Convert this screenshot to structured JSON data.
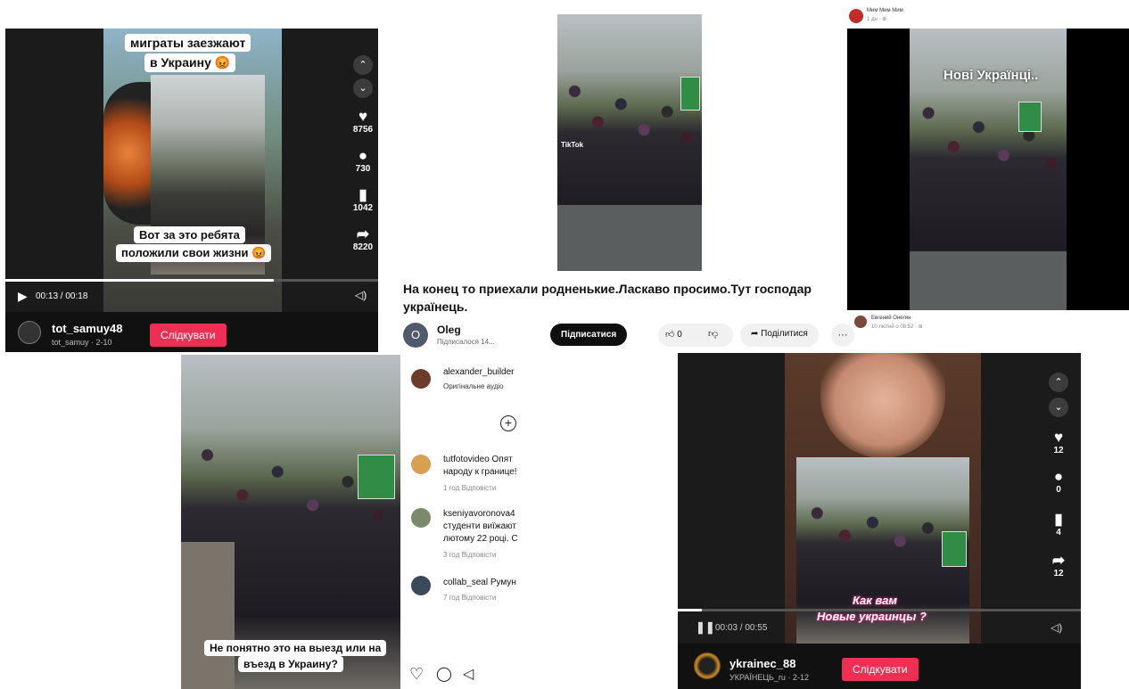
{
  "video1": {
    "caption_top_1": "миграты заезжают",
    "caption_top_2": "в Украину 😡",
    "caption_bottom_1": "Вот за это ребята",
    "caption_bottom_2": "положили свои жизни 😡",
    "likes": "8756",
    "comments": "730",
    "saves": "1042",
    "shares": "8220",
    "time": "00:13 / 00:18",
    "progress": 0.72,
    "username": "tot_samuy48",
    "sub": "tot_samuy · 2-10",
    "follow": "Слідкувати"
  },
  "video2": {
    "watermark": "TikTok"
  },
  "post": {
    "title": "На конец то приехали родненькие.Ласкаво просимо.Тут господар українець.",
    "channel": "Oleg",
    "avatar_letter": "O",
    "subscribers": "Підписалося 14...",
    "subscribe": "Підписатися",
    "likes": "0",
    "share": "Поділитися",
    "more": "···"
  },
  "fb": {
    "author_top": "Мим Мим Мим",
    "time_top": "1 дн · ⊕",
    "caption": "Нові Українці..",
    "author_bottom": "Евгений Онегин",
    "time_bottom": "10 лютий о 08:52 · ⊕"
  },
  "insta": {
    "caption_1": "Не понятно это на выезд или на",
    "caption_2": "въезд в Украину?",
    "author": "alexander_builder",
    "audio": "Оригінальне аудіо",
    "comments": [
      {
        "user": "tutfotovideo",
        "text1": "Опят",
        "text2": "народу к границе!",
        "meta": "1 год  Відповісти"
      },
      {
        "user": "kseniyavoronova4",
        "text1": "",
        "text2": "студенти виїжают",
        "text3": "лютому 22 році. С",
        "meta": "3 год  Відповісти"
      },
      {
        "user": "collab_seal",
        "text1": "Румун",
        "meta": "7 год  Відповісти"
      }
    ]
  },
  "video3": {
    "caption_1": "Как вам",
    "caption_2": "Новые украинцы ?",
    "likes": "12",
    "comments": "0",
    "saves": "4",
    "shares": "12",
    "time": "00:03 / 00:55",
    "progress": 0.06,
    "username": "ykrainec_88",
    "sub": "УКРАЇНЕЦЬ_ru · 2-12",
    "follow": "Слідкувати"
  },
  "colors": {
    "follow": "#ee2f53",
    "dark": "#1b1b1b",
    "fb_caption": "#ffffff"
  }
}
